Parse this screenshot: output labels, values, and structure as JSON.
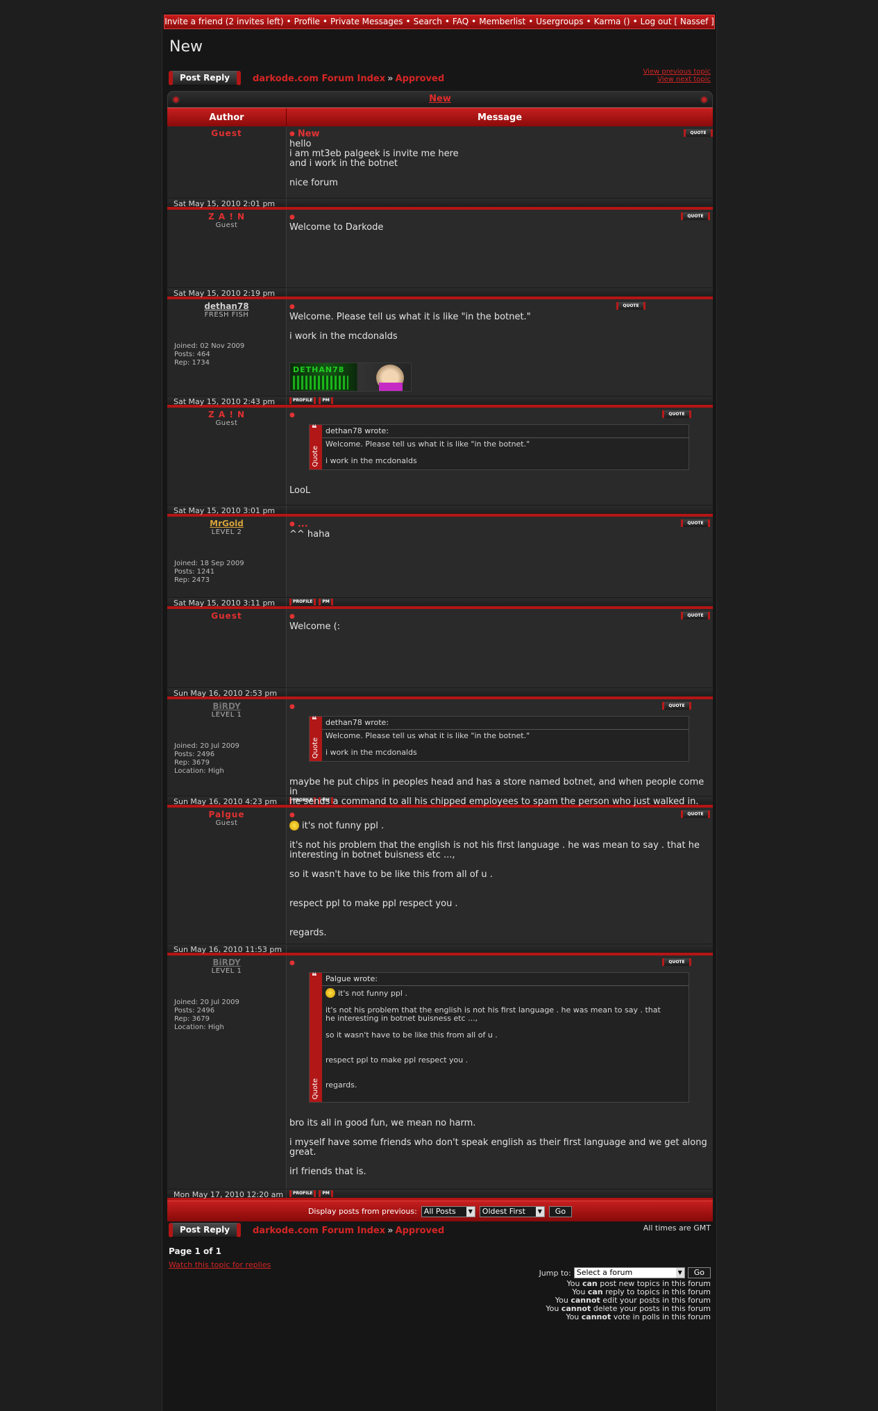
{
  "topnav": {
    "items": [
      "Invite a friend (2 invites left)",
      "Profile",
      "Private Messages",
      "Search",
      "FAQ",
      "Memberlist",
      "Usergroups",
      "Karma ()",
      "Log out [ Nassef ]"
    ]
  },
  "topic": {
    "title": "New"
  },
  "nav": {
    "post_reply": "Post Reply",
    "forum_index": "darkode.com Forum Index",
    "sep": "»",
    "subforum": "Approved",
    "prev_topic": "View previous topic",
    "next_topic": "View next topic"
  },
  "thread": {
    "title": "New",
    "col_author": "Author",
    "col_message": "Message"
  },
  "buttons": {
    "quote": "QUOTE",
    "profile": "PROFILE",
    "pm": "PM"
  },
  "posts": [
    {
      "author": "Guest",
      "rank": "",
      "style": "guest",
      "subject": "New",
      "lines": [
        "hello",
        "i am mt3eb palgeek is invite me here",
        "and i work in the botnet",
        "",
        "nice forum"
      ],
      "date": "Sat May 15, 2010 2:01 pm"
    },
    {
      "author": "Z A ! N",
      "rank": "Guest",
      "style": "guest",
      "subject": "",
      "lines": [
        "Welcome to Darkode"
      ],
      "date": "Sat May 15, 2010 2:19 pm"
    },
    {
      "author": "dethan78",
      "rank": "FRESH FISH",
      "style": "member",
      "stats": [
        "Joined: 02 Nov 2009",
        "Posts: 464",
        "Rep: 1734"
      ],
      "subject": "",
      "lines": [
        "Welcome. Please tell us what it is like \"in the botnet.\"",
        "",
        "i work in the mcdonalds"
      ],
      "signature": "DETHAN78",
      "date": "Sat May 15, 2010 2:43 pm"
    },
    {
      "author": "Z A ! N",
      "rank": "Guest",
      "style": "guest",
      "subject": "",
      "quote": {
        "label": "Quote",
        "head": "dethan78 wrote:",
        "lines": [
          "Welcome. Please tell us what it is like \"in the botnet.\"",
          "",
          "i work in the mcdonalds"
        ]
      },
      "lines": [
        "LooL"
      ],
      "date": "Sat May 15, 2010 3:01 pm"
    },
    {
      "author": "MrGold",
      "rank": "LEVEL 2",
      "style": "gold",
      "stats": [
        "Joined: 18 Sep 2009",
        "Posts: 1241",
        "Rep: 2473"
      ],
      "subject": "...",
      "lines": [
        "^^ haha"
      ],
      "date": "Sat May 15, 2010 3:11 pm"
    },
    {
      "author": "Guest",
      "rank": "",
      "style": "guest",
      "subject": "",
      "lines": [
        "Welcome (:"
      ],
      "date": "Sun May 16, 2010 2:53 pm"
    },
    {
      "author": "BiRDY",
      "rank": "LEVEL 1",
      "style": "grey",
      "stats": [
        "Joined: 20 Jul 2009",
        "Posts: 2496",
        "Rep: 3679",
        "Location: High"
      ],
      "subject": "",
      "quote": {
        "label": "Quote",
        "head": "dethan78 wrote:",
        "lines": [
          "Welcome. Please tell us what it is like \"in the botnet.\"",
          "",
          "i work in the mcdonalds"
        ]
      },
      "lines": [
        "maybe he put chips in peoples head and has a store named botnet, and when people come in",
        "he sends a command to all his chipped employees to spam the person who just walked in."
      ],
      "date": "Sun May 16, 2010 4:23 pm"
    },
    {
      "author": "Palgue",
      "rank": "Guest",
      "style": "guest",
      "subject": "",
      "lines": [
        "it's not funny ppl .",
        "",
        "it's not his problem that the english is not his first language . he was mean to say . that he",
        "interesting in botnet buisness etc ...,",
        "",
        "so it wasn't have to be like this from all of u .",
        "",
        "",
        "respect ppl to make ppl respect you .",
        "",
        "",
        "regards."
      ],
      "date": "Sun May 16, 2010 11:53 pm"
    },
    {
      "author": "BiRDY",
      "rank": "LEVEL 1",
      "style": "grey",
      "stats": [
        "Joined: 20 Jul 2009",
        "Posts: 2496",
        "Rep: 3679",
        "Location: High"
      ],
      "subject": "",
      "quote": {
        "label": "Quote",
        "head": "Palgue wrote:",
        "lines": [
          "it's not funny ppl .",
          "",
          "it's not his problem that the english is not his first language . he was mean to say . that",
          "he interesting in botnet buisness etc ...,",
          "",
          "so it wasn't have to be like this from all of u .",
          "",
          "",
          "respect ppl to make ppl respect you .",
          "",
          "",
          "regards."
        ]
      },
      "lines": [
        "bro its all in good fun, we mean no harm.",
        "",
        "i myself have some friends who don't speak english as their first language and we get along",
        "great.",
        "",
        "irl friends that is."
      ],
      "date": "Mon May 17, 2010 12:20 am"
    }
  ],
  "display": {
    "label": "Display posts from previous:",
    "period": "All Posts",
    "order": "Oldest First",
    "go": "Go"
  },
  "footer": {
    "timezone": "All times are GMT",
    "page": "Page 1 of 1",
    "watch": "Watch this topic for replies",
    "jump_label": "Jump to:",
    "jump_select": "Select a forum",
    "go": "Go",
    "permissions": [
      [
        "You ",
        "can",
        " post new topics in this forum"
      ],
      [
        "You ",
        "can",
        " reply to topics in this forum"
      ],
      [
        "You ",
        "cannot",
        " edit your posts in this forum"
      ],
      [
        "You ",
        "cannot",
        " delete your posts in this forum"
      ],
      [
        "You ",
        "cannot",
        " vote in polls in this forum"
      ]
    ]
  }
}
